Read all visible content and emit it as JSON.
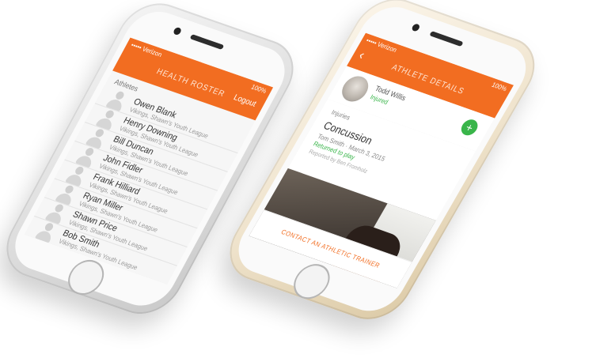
{
  "left_phone": {
    "status": {
      "carrier": "••••• Verizon",
      "right": "100%"
    },
    "title": "HEALTH ROSTER",
    "header_link": "Logout",
    "section": "Athletes",
    "athletes": [
      {
        "name": "Owen Blank",
        "team": "Vikings, Shawn's Youth League"
      },
      {
        "name": "Henry Downing",
        "team": "Vikings, Shawn's Youth League"
      },
      {
        "name": "Bill Duncan",
        "team": "Vikings, Shawn's Youth League"
      },
      {
        "name": "John Fidler",
        "team": "Vikings, Shawn's Youth League"
      },
      {
        "name": "Frank Hilliard",
        "team": "Vikings, Shawn's Youth League"
      },
      {
        "name": "Ryan Miller",
        "team": "Vikings, Shawn's Youth League"
      },
      {
        "name": "Shawn Price",
        "team": "Vikings, Shawn's Youth League"
      },
      {
        "name": "Bob Smith",
        "team": "Vikings, Shawn's Youth League"
      }
    ]
  },
  "right_phone": {
    "status": {
      "carrier": "••••• Verizon",
      "right": "100%"
    },
    "title": "ATHLETE DETAILS",
    "athlete": {
      "name": "Todd Willis",
      "status": "Injured"
    },
    "injury": {
      "label": "Injuries",
      "diagnosis": "Concussion",
      "meta": "Tom Smith · March 3, 2015",
      "return": "Returned to play",
      "reported": "Reported by Ben Fromholz"
    },
    "contact_label": "CONTACT AN ATHLETIC TRAINER"
  },
  "colors": {
    "accent": "#f26d21",
    "green": "#39b54a"
  }
}
